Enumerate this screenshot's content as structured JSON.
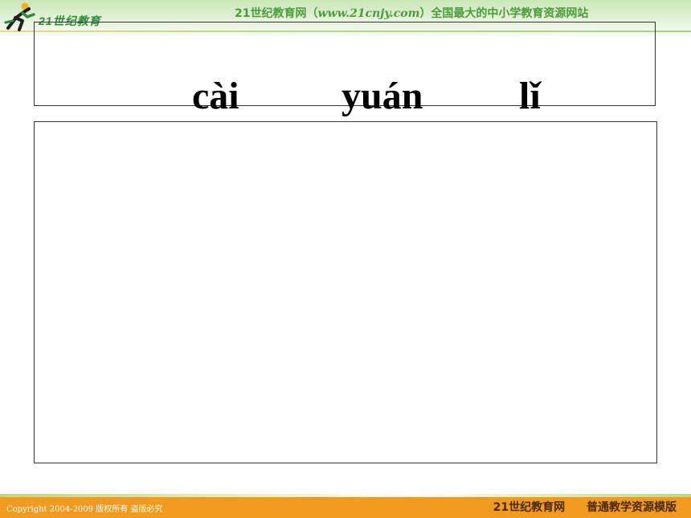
{
  "header": {
    "logo_text": "21世纪教育",
    "banner_prefix": "21世纪教育网（",
    "banner_url": "www.21cnjy.com",
    "banner_suffix": "）全国最大的中小学教育资源网站"
  },
  "pinyin": {
    "syllables": [
      "cài",
      "yuán",
      "lǐ"
    ]
  },
  "footer": {
    "copyright": "Copyright 2004-2009 版权所有 盗版必究",
    "site_name": "21世纪教育网",
    "template_name": "普通教学资源模版"
  },
  "colors": {
    "header_green": "#c9e6b6",
    "footer_orange": "#f09a1f",
    "banner_text": "#4d9c3c"
  }
}
